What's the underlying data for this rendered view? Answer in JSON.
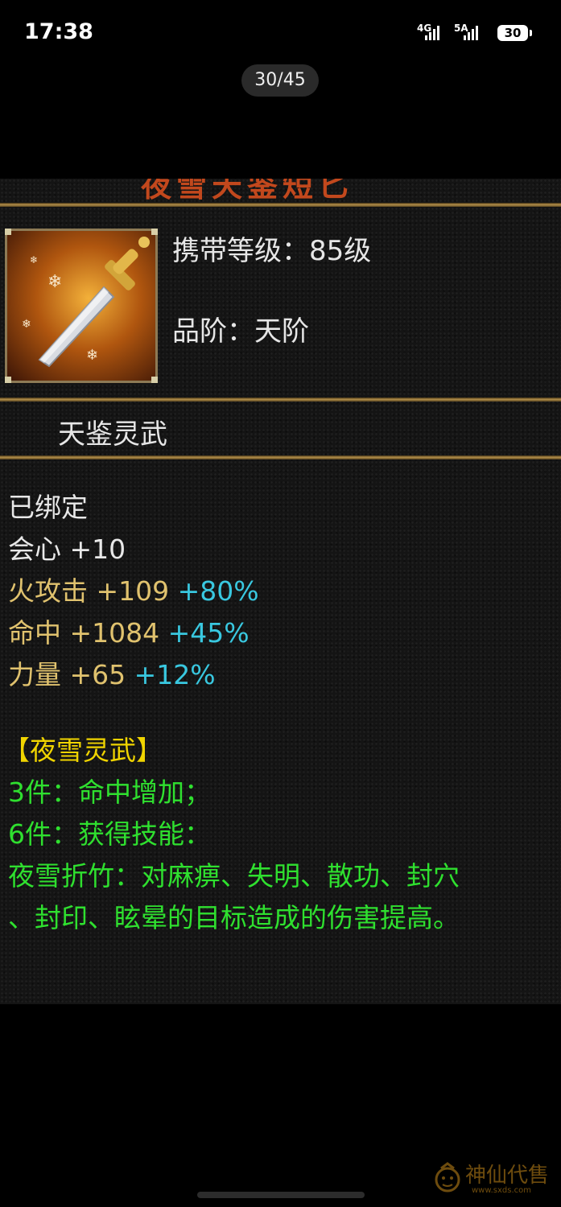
{
  "status_bar": {
    "time": "17:38",
    "net1": "4G",
    "net2": "5A",
    "battery": "30"
  },
  "viewer": {
    "counter": "30/45"
  },
  "item": {
    "title_fragment": "夜雪天鉴短匕",
    "carry_level_label": "携带等级：",
    "carry_level_value": "85级",
    "grade_label": "品阶：",
    "grade_value": "天阶",
    "item_name": "天鉴灵武",
    "bound": "已绑定",
    "stats": [
      {
        "name": "会心",
        "value": "+10",
        "bonus": ""
      },
      {
        "name": "火攻击",
        "value": "+109",
        "bonus": "+80%"
      },
      {
        "name": "命中",
        "value": "+1084",
        "bonus": "+45%"
      },
      {
        "name": "力量",
        "value": "+65",
        "bonus": "+12%"
      }
    ],
    "set_name": "【夜雪灵武】",
    "set_lines": [
      "3件：命中增加；",
      "6件：获得技能：",
      "夜雪折竹：对麻痹、失明、散功、封穴",
      "、封印、眩晕的目标造成的伤害提高。"
    ]
  },
  "watermark": {
    "text": "神仙代售",
    "url": "www.sxds.com"
  }
}
